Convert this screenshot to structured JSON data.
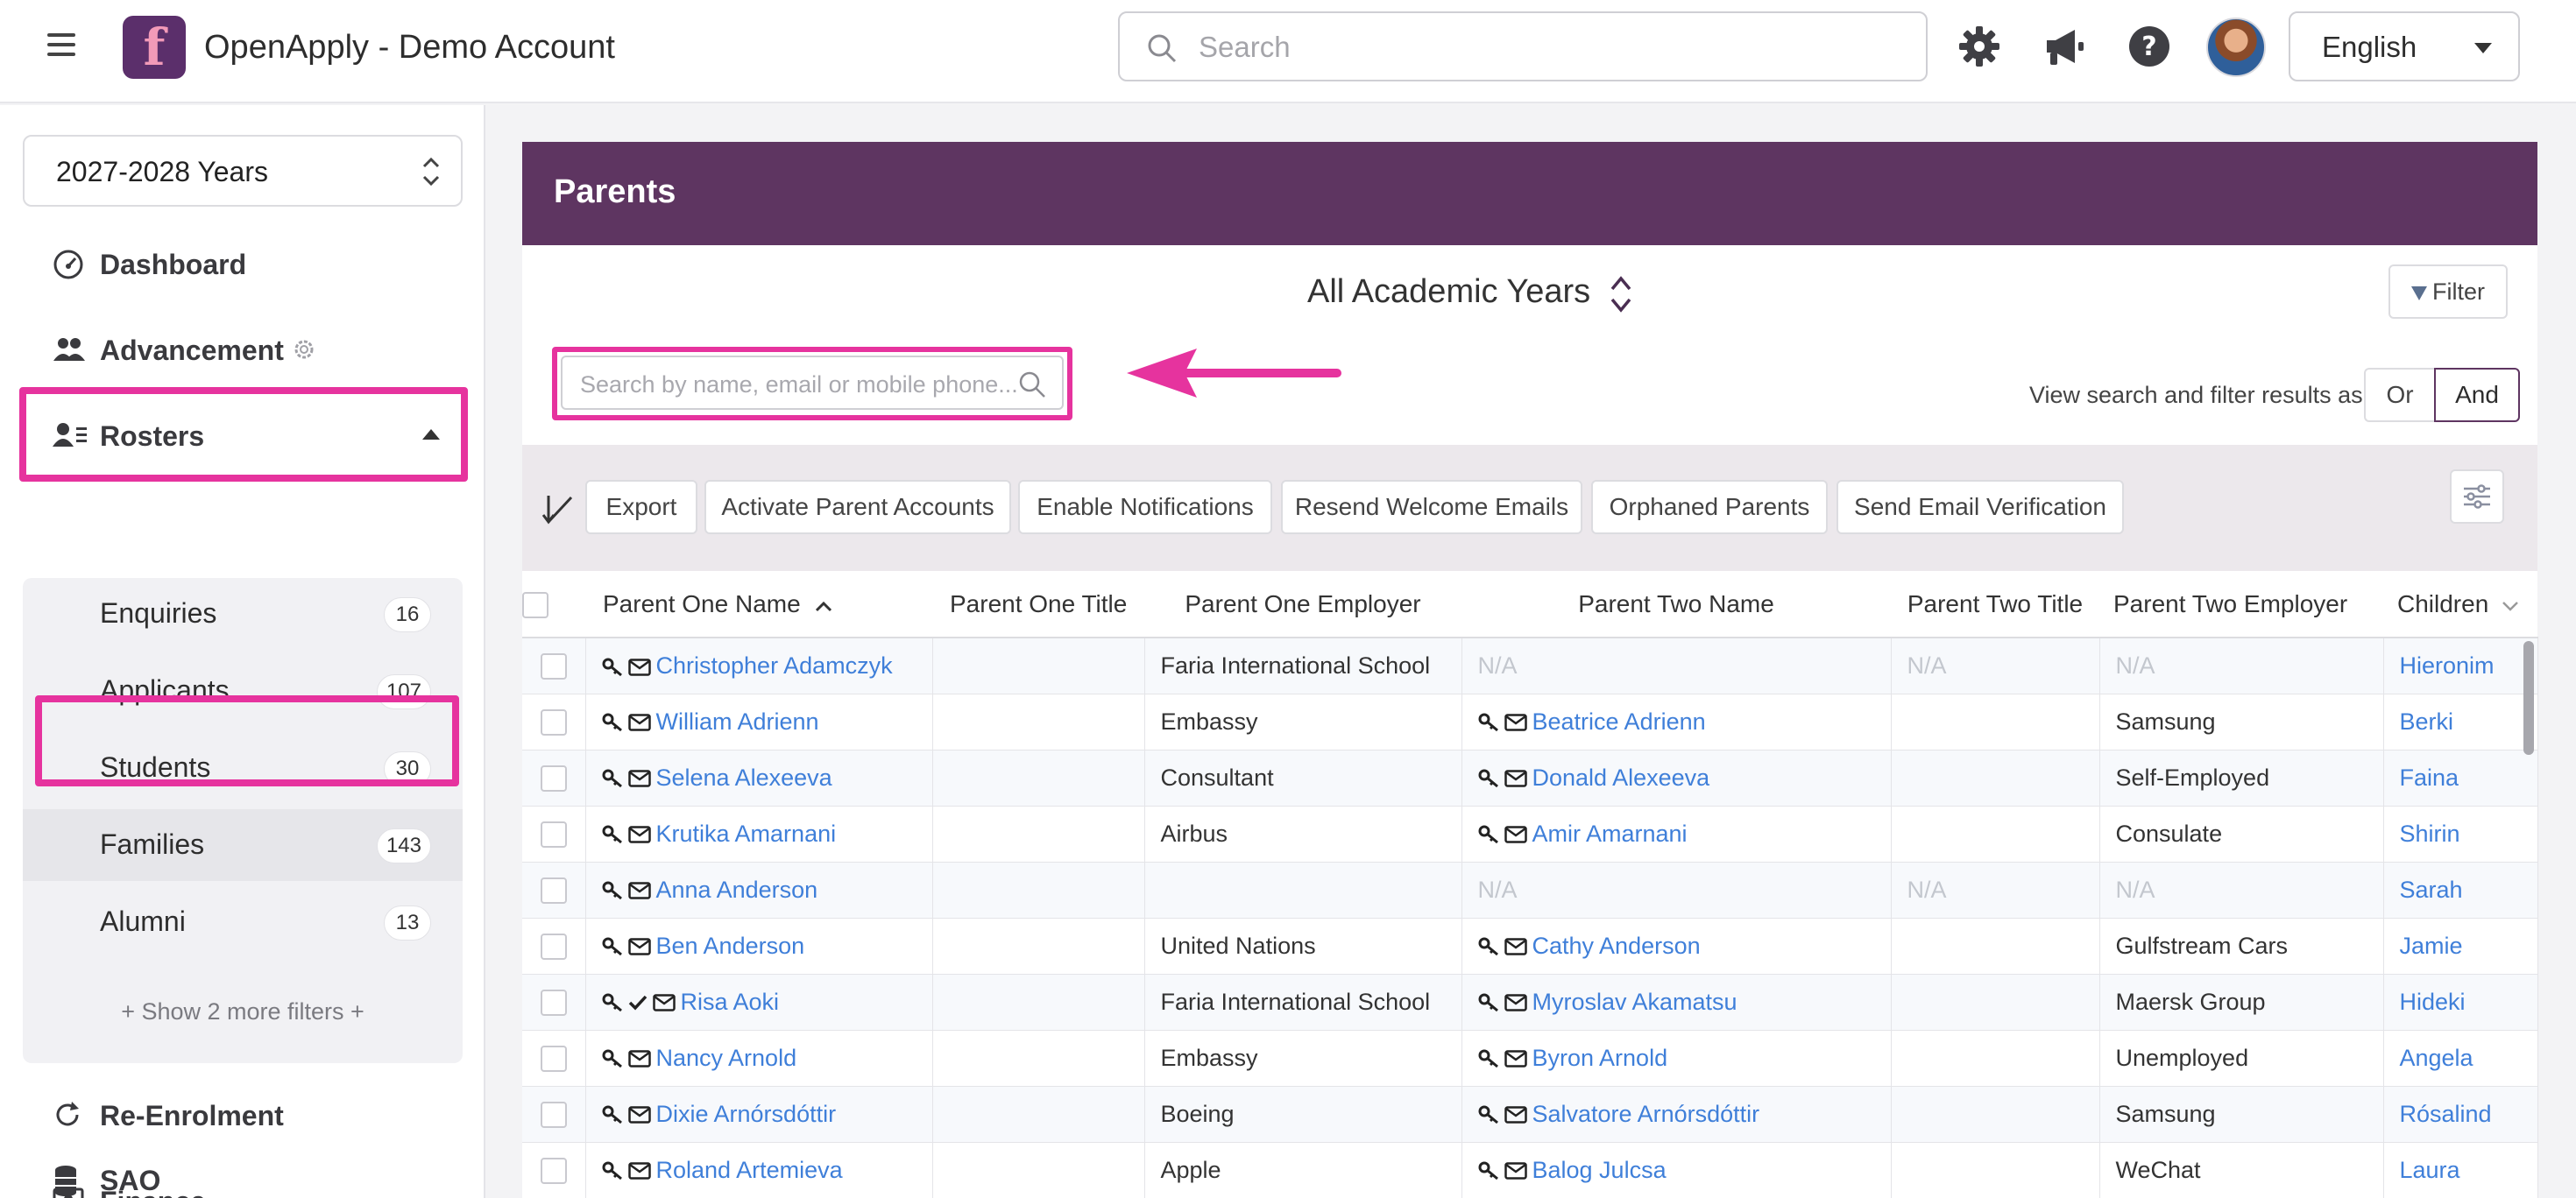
{
  "header": {
    "app_title": "OpenApply - Demo Account",
    "search_placeholder": "Search",
    "language": "English"
  },
  "sidebar": {
    "year_select": "2027-2028 Years",
    "nav": [
      {
        "label": "Dashboard",
        "icon": "dashboard-icon"
      },
      {
        "label": "Advancement",
        "icon": "people-icon"
      },
      {
        "label": "Rosters",
        "icon": "roster-icon"
      },
      {
        "label": "Re-Enrolment",
        "icon": "refresh-icon"
      },
      {
        "label": "Finance",
        "icon": "cash-icon"
      },
      {
        "label": "SAO",
        "icon": "database-icon"
      }
    ],
    "rosters_sub": [
      {
        "label": "Enquiries",
        "count": "16"
      },
      {
        "label": "Applicants",
        "count": "107"
      },
      {
        "label": "Students",
        "count": "30"
      },
      {
        "label": "Families",
        "count": "143"
      },
      {
        "label": "Alumni",
        "count": "13"
      }
    ],
    "more_filters": "+ Show 2 more filters +"
  },
  "page": {
    "title": "Parents",
    "academic_years": "All Academic Years",
    "filter_label": "Filter",
    "search_placeholder": "Search by name, email or mobile phone...",
    "view_as_label": "View search and filter results as:",
    "or_label": "Or",
    "and_label": "And"
  },
  "toolbar": {
    "buttons": [
      "Export",
      "Activate Parent Accounts",
      "Enable Notifications",
      "Resend Welcome Emails",
      "Orphaned Parents",
      "Send Email Verification"
    ]
  },
  "table": {
    "columns": [
      "Parent One Name",
      "Parent One Title",
      "Parent One Employer",
      "Parent Two Name",
      "Parent Two Title",
      "Parent Two Employer",
      "Children"
    ],
    "rows": [
      {
        "p1": "Christopher Adamczyk",
        "p1_title": "",
        "p1_emp": "Faria International School",
        "p2": "N/A",
        "p2_title": "N/A",
        "p2_emp": "N/A",
        "child": "Hieronim"
      },
      {
        "p1": "William Adrienn",
        "p1_title": "",
        "p1_emp": "Embassy",
        "p2": "Beatrice Adrienn",
        "p2_title": "",
        "p2_emp": "Samsung",
        "child": "Berki"
      },
      {
        "p1": "Selena Alexeeva",
        "p1_title": "",
        "p1_emp": "Consultant",
        "p2": "Donald Alexeeva",
        "p2_title": "",
        "p2_emp": "Self-Employed",
        "child": "Faina"
      },
      {
        "p1": "Krutika Amarnani",
        "p1_title": "",
        "p1_emp": "Airbus",
        "p2": "Amir Amarnani",
        "p2_title": "",
        "p2_emp": "Consulate",
        "child": "Shirin"
      },
      {
        "p1": "Anna Anderson",
        "p1_title": "",
        "p1_emp": "",
        "p2": "N/A",
        "p2_title": "N/A",
        "p2_emp": "N/A",
        "child": "Sarah"
      },
      {
        "p1": "Ben Anderson",
        "p1_title": "",
        "p1_emp": "United Nations",
        "p2": "Cathy Anderson",
        "p2_title": "",
        "p2_emp": "Gulfstream Cars",
        "child": "Jamie"
      },
      {
        "p1": "Risa Aoki",
        "p1_title": "",
        "p1_emp": "Faria International School",
        "p2": "Myroslav Akamatsu",
        "p2_title": "",
        "p2_emp": "Maersk Group",
        "child": "Hideki"
      },
      {
        "p1": "Nancy Arnold",
        "p1_title": "",
        "p1_emp": "Embassy",
        "p2": "Byron Arnold",
        "p2_title": "",
        "p2_emp": "Unemployed",
        "child": "Angela"
      },
      {
        "p1": "Dixie Arnórsdóttir",
        "p1_title": "",
        "p1_emp": "Boeing",
        "p2": "Salvatore Arnórsdóttir",
        "p2_title": "",
        "p2_emp": "Samsung",
        "child": "Rósalind"
      },
      {
        "p1": "Roland Artemieva",
        "p1_title": "",
        "p1_emp": "Apple",
        "p2": "Balog Julcsa",
        "p2_title": "",
        "p2_emp": "WeChat",
        "child": "Laura"
      }
    ]
  },
  "colors": {
    "brand_purple": "#5e3561",
    "highlight_pink": "#e6339e",
    "link_blue": "#3f7fd9"
  }
}
